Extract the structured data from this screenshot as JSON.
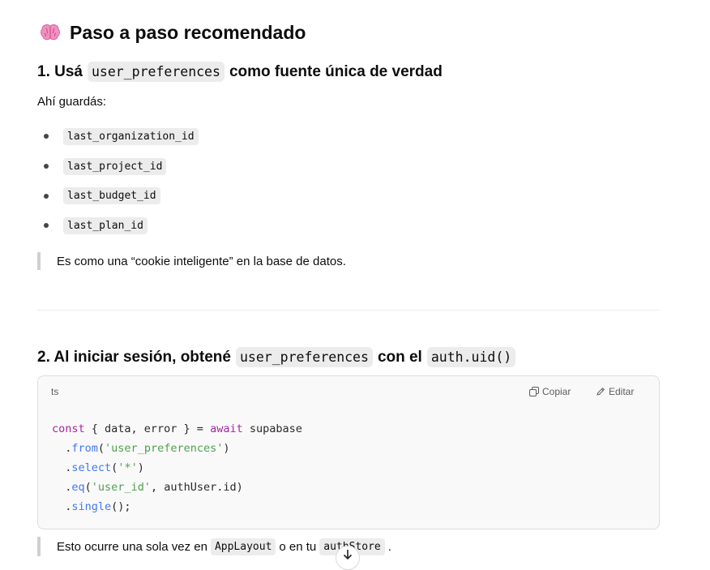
{
  "section": {
    "emoji_icon": "brain-icon",
    "title": "Paso a paso recomendado"
  },
  "step1": {
    "prefix": "1. Usá",
    "code": "user_preferences",
    "suffix": "como fuente única de verdad",
    "intro": "Ahí guardás:",
    "items": [
      "last_organization_id",
      "last_project_id",
      "last_budget_id",
      "last_plan_id"
    ],
    "quote": "Es como una “cookie inteligente” en la base de datos."
  },
  "step2": {
    "prefix": "2. Al iniciar sesión, obtené",
    "code1": "user_preferences",
    "middle": "con el",
    "code2": "auth.uid()"
  },
  "codeblock": {
    "lang": "ts",
    "copy_label": "Copiar",
    "edit_label": "Editar",
    "lines": [
      [
        {
          "t": "kw",
          "v": "const"
        },
        {
          "t": "",
          "v": " { data, error } = "
        },
        {
          "t": "kw",
          "v": "await"
        },
        {
          "t": "",
          "v": " supabase"
        }
      ],
      [
        {
          "t": "",
          "v": "  ."
        },
        {
          "t": "fn",
          "v": "from"
        },
        {
          "t": "",
          "v": "("
        },
        {
          "t": "str",
          "v": "'user_preferences'"
        },
        {
          "t": "",
          "v": ")"
        }
      ],
      [
        {
          "t": "",
          "v": "  ."
        },
        {
          "t": "fn",
          "v": "select"
        },
        {
          "t": "",
          "v": "("
        },
        {
          "t": "str",
          "v": "'*'"
        },
        {
          "t": "",
          "v": ")"
        }
      ],
      [
        {
          "t": "",
          "v": "  ."
        },
        {
          "t": "fn",
          "v": "eq"
        },
        {
          "t": "",
          "v": "("
        },
        {
          "t": "str",
          "v": "'user_id'"
        },
        {
          "t": "",
          "v": ", authUser.id)"
        }
      ],
      [
        {
          "t": "",
          "v": "  ."
        },
        {
          "t": "fn",
          "v": "single"
        },
        {
          "t": "",
          "v": "();"
        }
      ]
    ]
  },
  "note": {
    "prefix": "Esto ocurre una sola vez en",
    "code1": "AppLayout",
    "middle": "o en tu",
    "code2": "authStore",
    "suffix": "."
  }
}
